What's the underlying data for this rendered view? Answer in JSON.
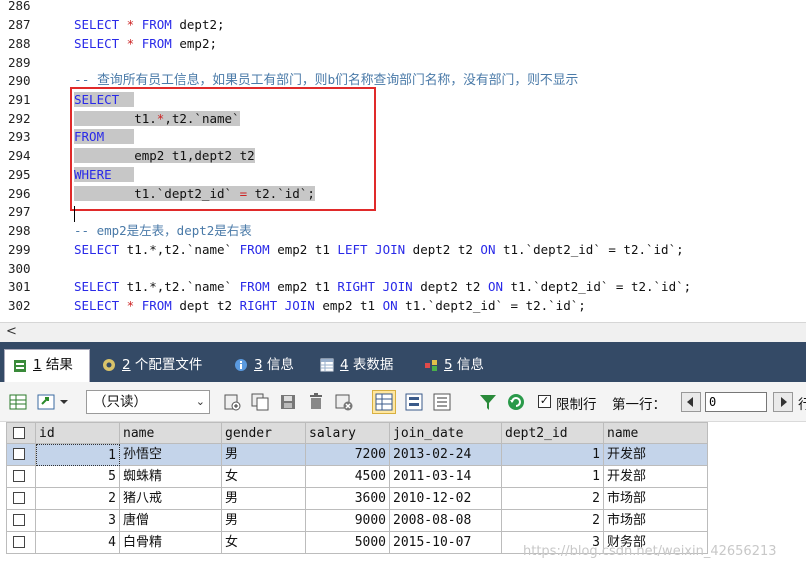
{
  "editor": {
    "line_numbers": [
      "286",
      "287",
      "288",
      "289",
      "290",
      "291",
      "292",
      "293",
      "294",
      "295",
      "296",
      "297",
      "298",
      "299",
      "300",
      "301",
      "302"
    ],
    "lines": {
      "l287": {
        "kw1": "SELECT",
        "op1": " * ",
        "kw2": "FROM",
        "rest": " dept2;"
      },
      "l288": {
        "kw1": "SELECT",
        "op1": " * ",
        "kw2": "FROM",
        "rest": " emp2;"
      },
      "l290": {
        "comment": "-- 查询所有员工信息，如果员工有部门，则b们名称查询部门名称，没有部门，则不显示"
      },
      "l291": {
        "kw": "SELECT"
      },
      "l292": {
        "pre": "        t1.",
        "op": "*",
        "post": ",t2.`name`"
      },
      "l293": {
        "kw": "FROM"
      },
      "l294": {
        "text": "        emp2 t1,dept2 t2"
      },
      "l295": {
        "kw": "WHERE"
      },
      "l296": {
        "pre": "        t1.`dept2_id` ",
        "op": "=",
        "post": " t2.`id`;"
      },
      "l298": {
        "comment": "-- emp2是左表，dept2是右表"
      },
      "l299": {
        "kw1": "SELECT",
        "t1": " t1.*,t2.`name` ",
        "kw2": "FROM",
        "t2": " emp2 t1 ",
        "kw3": "LEFT JOIN",
        "t3": " dept2 t2 ",
        "kw4": "ON",
        "t4": " t1.`dept2_id` = t2.`id`;"
      },
      "l301": {
        "kw1": "SELECT",
        "t1": " t1.*,t2.`name` ",
        "kw2": "FROM",
        "t2": " emp2 t1 ",
        "kw3": "RIGHT JOIN",
        "t3": " dept2 t2 ",
        "kw4": "ON",
        "t4": " t1.`dept2_id` = t2.`id`;"
      },
      "l302": {
        "kw1": "SELECT",
        "op1": " * ",
        "kw2": "FROM",
        "t2": " dept t2 ",
        "kw3": "RIGHT JOIN",
        "t3": " emp2 t1 ",
        "kw4": "ON",
        "t4": " t1.`dept2_id` = t2.`id`;"
      }
    },
    "scroll_left_glyph": "<"
  },
  "tabs": [
    {
      "num": "1",
      "label": " 结果",
      "icon": "result-grid-icon"
    },
    {
      "num": "2",
      "label": " 个配置文件",
      "icon": "profile-icon"
    },
    {
      "num": "3",
      "label": " 信息",
      "icon": "info-icon"
    },
    {
      "num": "4",
      "label": " 表数据",
      "icon": "table-data-icon"
    },
    {
      "num": "5",
      "label": " 信息",
      "icon": "info-tree-icon"
    }
  ],
  "toolbar": {
    "readonly_value": "（只读）",
    "limit_rows_checked": true,
    "limit_rows_label": "限制行",
    "first_row_label": "第一行：",
    "first_row_value": "0",
    "extra_label": "行"
  },
  "grid": {
    "columns": [
      "id",
      "name",
      "gender",
      "salary",
      "join_date",
      "dept2_id",
      "name"
    ],
    "rows": [
      [
        "1",
        "孙悟空",
        "男",
        "7200",
        "2013-02-24",
        "1",
        "开发部"
      ],
      [
        "5",
        "蜘蛛精",
        "女",
        "4500",
        "2011-03-14",
        "1",
        "开发部"
      ],
      [
        "2",
        "猪八戒",
        "男",
        "3600",
        "2010-12-02",
        "2",
        "市场部"
      ],
      [
        "3",
        "唐僧",
        "男",
        "9000",
        "2008-08-08",
        "2",
        "市场部"
      ],
      [
        "4",
        "白骨精",
        "女",
        "5000",
        "2015-10-07",
        "3",
        "财务部"
      ]
    ]
  },
  "watermark": "https://blog.csdn.net/weixin_42656213",
  "colors": {
    "keyword": "#2a2ae8",
    "comment": "#4a7aa8",
    "operator": "#cc2222",
    "highlight_box": "#e02a2a",
    "tabbar": "#344a66",
    "selected_row": "#c4d4ea"
  }
}
